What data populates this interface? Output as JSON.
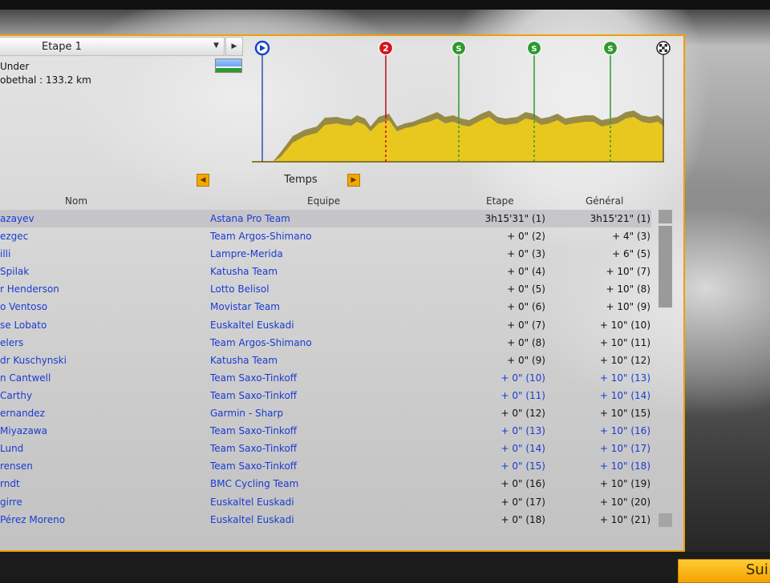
{
  "stage_selector": {
    "label": "Etape 1"
  },
  "stage_info": {
    "line1": "Under",
    "line2": "obethal : 133.2 km"
  },
  "profile": {
    "markers": [
      {
        "type": "start",
        "symbol": "▶",
        "color": "#1646c8"
      },
      {
        "type": "climb",
        "symbol": "2",
        "color": "#d2141e"
      },
      {
        "type": "sprint",
        "symbol": "S",
        "color": "#2e9a2e"
      },
      {
        "type": "sprint",
        "symbol": "S",
        "color": "#2e9a2e"
      },
      {
        "type": "sprint",
        "symbol": "S",
        "color": "#2e9a2e"
      },
      {
        "type": "finish",
        "symbol": "",
        "color": "#222222"
      }
    ]
  },
  "ranking_mode": {
    "label": "Temps"
  },
  "table": {
    "headers": {
      "name": "Nom",
      "team": "Equipe",
      "stage": "Etape",
      "general": "Général"
    },
    "rows": [
      {
        "name": "azayev",
        "team": "Astana Pro Team",
        "stage": "3h15'31\" (1)",
        "general": "3h15'21\" (1)",
        "selected": true,
        "highlight": false
      },
      {
        "name": "ezgec",
        "team": "Team Argos-Shimano",
        "stage": "+ 0\" (2)",
        "general": "+ 4\" (3)",
        "selected": false,
        "highlight": false
      },
      {
        "name": "illi",
        "team": "Lampre-Merida",
        "stage": "+ 0\" (3)",
        "general": "+ 6\" (5)",
        "selected": false,
        "highlight": false
      },
      {
        "name": "Spilak",
        "team": "Katusha Team",
        "stage": "+ 0\" (4)",
        "general": "+ 10\" (7)",
        "selected": false,
        "highlight": false
      },
      {
        "name": "r Henderson",
        "team": "Lotto Belisol",
        "stage": "+ 0\" (5)",
        "general": "+ 10\" (8)",
        "selected": false,
        "highlight": false
      },
      {
        "name": "o Ventoso",
        "team": "Movistar Team",
        "stage": "+ 0\" (6)",
        "general": "+ 10\" (9)",
        "selected": false,
        "highlight": false
      },
      {
        "name": "se Lobato",
        "team": "Euskaltel Euskadi",
        "stage": "+ 0\" (7)",
        "general": "+ 10\" (10)",
        "selected": false,
        "highlight": false
      },
      {
        "name": "elers",
        "team": "Team Argos-Shimano",
        "stage": "+ 0\" (8)",
        "general": "+ 10\" (11)",
        "selected": false,
        "highlight": false
      },
      {
        "name": "dr Kuschynski",
        "team": "Katusha Team",
        "stage": "+ 0\" (9)",
        "general": "+ 10\" (12)",
        "selected": false,
        "highlight": false
      },
      {
        "name": "n Cantwell",
        "team": "Team Saxo-Tinkoff",
        "stage": "+ 0\" (10)",
        "general": "+ 10\" (13)",
        "selected": false,
        "highlight": true
      },
      {
        "name": "Carthy",
        "team": "Team Saxo-Tinkoff",
        "stage": "+ 0\" (11)",
        "general": "+ 10\" (14)",
        "selected": false,
        "highlight": true
      },
      {
        "name": "ernandez",
        "team": "Garmin - Sharp",
        "stage": "+ 0\" (12)",
        "general": "+ 10\" (15)",
        "selected": false,
        "highlight": false
      },
      {
        "name": "Miyazawa",
        "team": "Team Saxo-Tinkoff",
        "stage": "+ 0\" (13)",
        "general": "+ 10\" (16)",
        "selected": false,
        "highlight": true
      },
      {
        "name": "Lund",
        "team": "Team Saxo-Tinkoff",
        "stage": "+ 0\" (14)",
        "general": "+ 10\" (17)",
        "selected": false,
        "highlight": true
      },
      {
        "name": "rensen",
        "team": "Team Saxo-Tinkoff",
        "stage": "+ 0\" (15)",
        "general": "+ 10\" (18)",
        "selected": false,
        "highlight": true
      },
      {
        "name": "rndt",
        "team": "BMC Cycling Team",
        "stage": "+ 0\" (16)",
        "general": "+ 10\" (19)",
        "selected": false,
        "highlight": false
      },
      {
        "name": "girre",
        "team": "Euskaltel Euskadi",
        "stage": "+ 0\" (17)",
        "general": "+ 10\" (20)",
        "selected": false,
        "highlight": false
      },
      {
        "name": "Pérez Moreno",
        "team": "Euskaltel Euskadi",
        "stage": "+ 0\" (18)",
        "general": "+ 10\" (21)",
        "selected": false,
        "highlight": false
      }
    ]
  },
  "footer": {
    "next_label": "Sui"
  }
}
